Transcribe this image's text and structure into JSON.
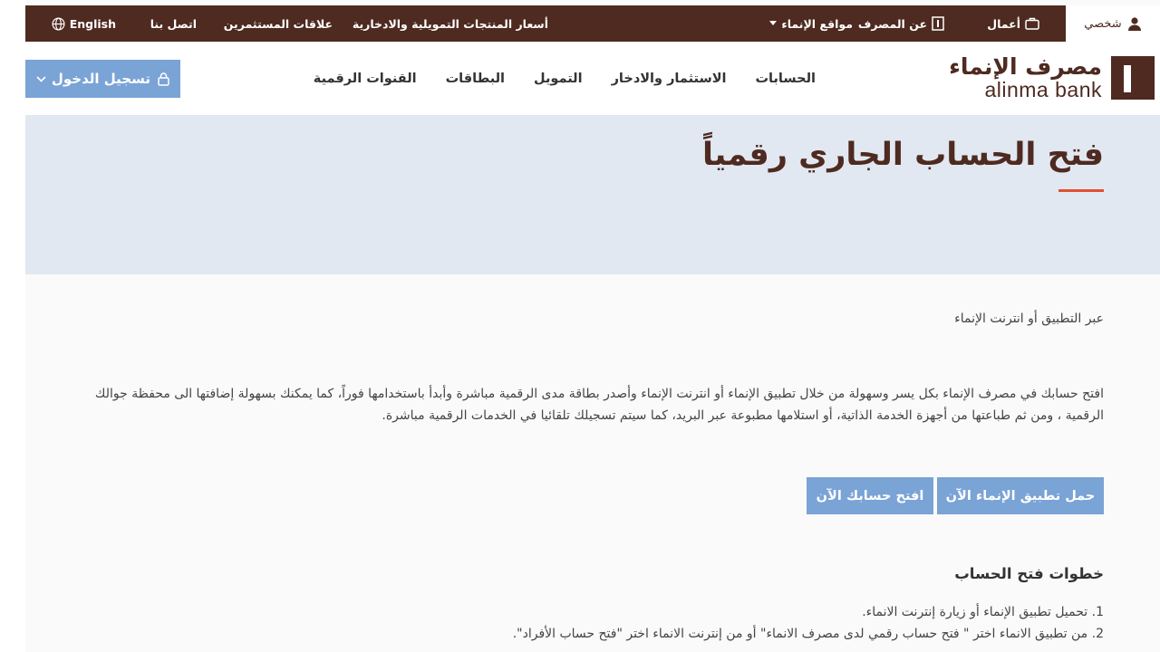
{
  "topbar": {
    "personal": "شخصي",
    "business": "أعمال",
    "about": "عن المصرف",
    "sites": "مواقع الإنماء",
    "prices": "أسعار المنتجات التمويلية والادخارية",
    "investors": "علاقات المستثمرين",
    "contact": "اتصل بنا",
    "language": "English"
  },
  "logo": {
    "arabic": "مصرف الإنماء",
    "english": "alinma bank"
  },
  "nav": {
    "items": [
      "الحسابات",
      "الاستثمار والادخار",
      "التمويل",
      "البطاقات",
      "القنوات الرقمية"
    ]
  },
  "login": {
    "label": "تسجيل الدخول"
  },
  "hero": {
    "title": "فتح الحساب الجاري رقمياً"
  },
  "content": {
    "subheading": "عبر التطبيق أو انترنت الإنماء",
    "paragraph": "افتح حسابك في مصرف الإنماء بكل يسر وسهولة من خلال تطبيق الإنماء أو انترنت الإنماء وأصدر بطاقة مدى الرقمية مباشرة وأبدأ باستخدامها فوراً، كما يمكنك بسهولة إضافتها الى محفظة جوالك الرقمية ، ومن ثم طباعتها من أجهزة الخدمة الذاتية، أو استلامها مطبوعة عبر البريد، كما سيتم تسجيلك تلقائيا في الخدمات الرقمية مباشرة.",
    "download_button": "حمل تطبيق الإنماء الآن",
    "open_button": "افتح حسابك الآن",
    "steps_title": "خطوات فتح الحساب",
    "steps": [
      "1. تحميل تطبيق الإنماء أو زيارة إنترنت الانماء.",
      "2. من تطبيق الانماء اختر \" فتح حساب رقمي لدى مصرف الانماء\" أو من إنترنت الانماء اختر \"فتح حساب الأفراد\"."
    ]
  }
}
